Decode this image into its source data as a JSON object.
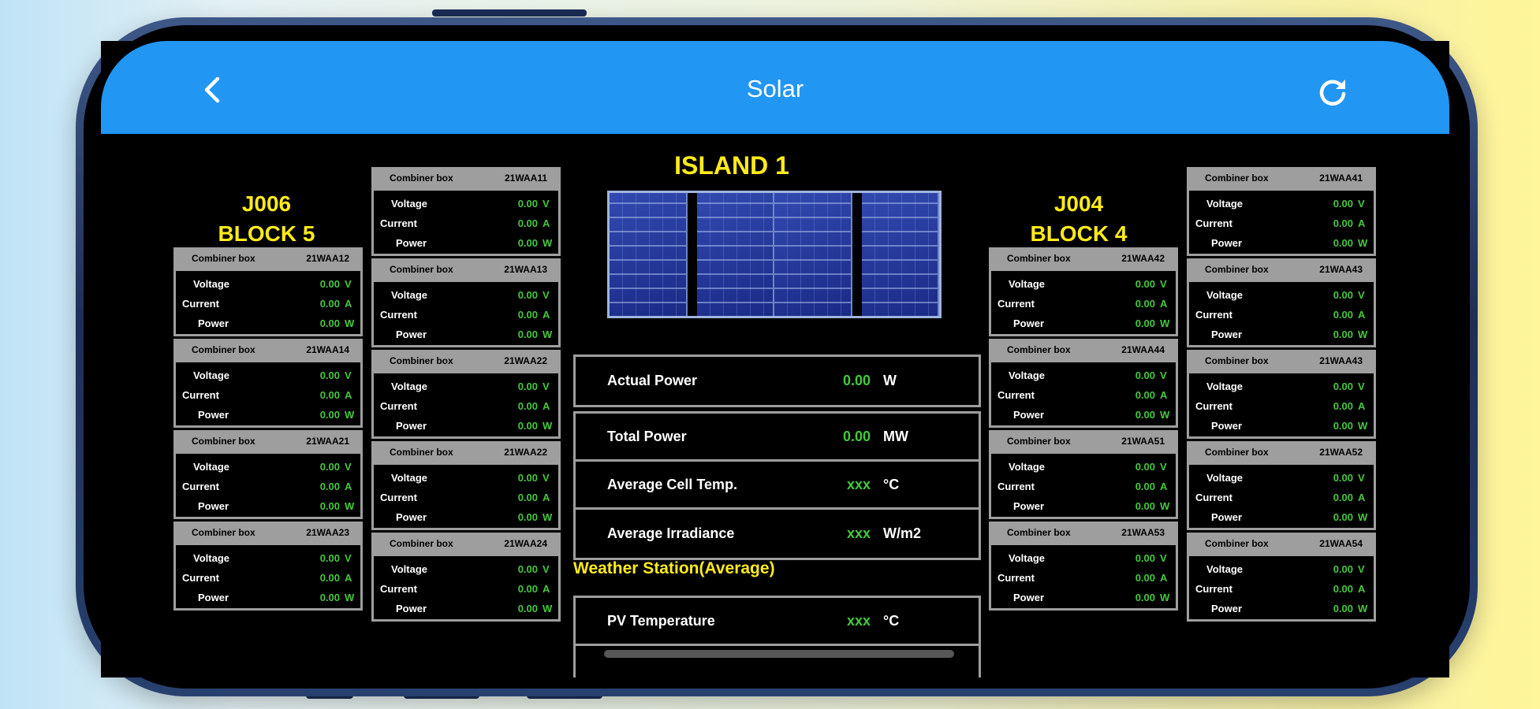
{
  "app": {
    "title": "Solar",
    "back_icon": "chevron-left-icon",
    "refresh_icon": "refresh-icon"
  },
  "left_block": {
    "line1": "J006",
    "line2": "BLOCK 5"
  },
  "right_block": {
    "line1": "J004",
    "line2": "BLOCK 4"
  },
  "labels": {
    "combiner": "Combiner box",
    "voltage": "Voltage",
    "current": "Current",
    "power": "Power",
    "unit_v": "V",
    "unit_a": "A",
    "unit_w": "W"
  },
  "columns": [
    {
      "boxes": [
        {
          "id": "21WAA12",
          "voltage": "0.00",
          "current": "0.00",
          "power": "0.00"
        },
        {
          "id": "21WAA14",
          "voltage": "0.00",
          "current": "0.00",
          "power": "0.00"
        },
        {
          "id": "21WAA21",
          "voltage": "0.00",
          "current": "0.00",
          "power": "0.00"
        },
        {
          "id": "21WAA23",
          "voltage": "0.00",
          "current": "0.00",
          "power": "0.00"
        }
      ]
    },
    {
      "boxes": [
        {
          "id": "21WAA11",
          "voltage": "0.00",
          "current": "0.00",
          "power": "0.00"
        },
        {
          "id": "21WAA13",
          "voltage": "0.00",
          "current": "0.00",
          "power": "0.00"
        },
        {
          "id": "21WAA22",
          "voltage": "0.00",
          "current": "0.00",
          "power": "0.00"
        },
        {
          "id": "21WAA22",
          "voltage": "0.00",
          "current": "0.00",
          "power": "0.00"
        },
        {
          "id": "21WAA24",
          "voltage": "0.00",
          "current": "0.00",
          "power": "0.00"
        }
      ]
    },
    {
      "boxes": [
        {
          "id": "21WAA42",
          "voltage": "0.00",
          "current": "0.00",
          "power": "0.00"
        },
        {
          "id": "21WAA44",
          "voltage": "0.00",
          "current": "0.00",
          "power": "0.00"
        },
        {
          "id": "21WAA51",
          "voltage": "0.00",
          "current": "0.00",
          "power": "0.00"
        },
        {
          "id": "21WAA53",
          "voltage": "0.00",
          "current": "0.00",
          "power": "0.00"
        }
      ]
    },
    {
      "boxes": [
        {
          "id": "21WAA41",
          "voltage": "0.00",
          "current": "0.00",
          "power": "0.00"
        },
        {
          "id": "21WAA43",
          "voltage": "0.00",
          "current": "0.00",
          "power": "0.00"
        },
        {
          "id": "21WAA43",
          "voltage": "0.00",
          "current": "0.00",
          "power": "0.00"
        },
        {
          "id": "21WAA52",
          "voltage": "0.00",
          "current": "0.00",
          "power": "0.00"
        },
        {
          "id": "21WAA54",
          "voltage": "0.00",
          "current": "0.00",
          "power": "0.00"
        }
      ]
    }
  ],
  "island": {
    "title": "ISLAND 1",
    "actual_power": {
      "label": "Actual Power",
      "value": "0.00",
      "unit": "W"
    },
    "total_power": {
      "label": "Total Power",
      "value": "0.00",
      "unit": "MW"
    },
    "avg_cell_temp": {
      "label": "Average Cell Temp.",
      "value": "xxx",
      "unit": "°C"
    },
    "avg_irradiance": {
      "label": "Average Irradiance",
      "value": "xxx",
      "unit": "W/m2"
    }
  },
  "weather": {
    "title": "Weather Station(Average)",
    "pv_temp": {
      "label": "PV Temperature",
      "value": "xxx",
      "unit": "°C"
    }
  }
}
